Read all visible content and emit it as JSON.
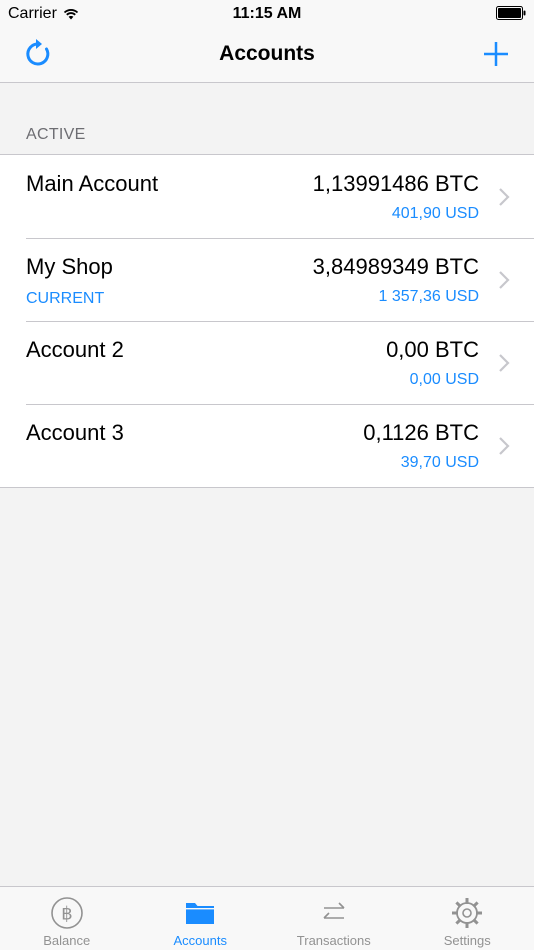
{
  "status_bar": {
    "carrier": "Carrier",
    "time": "11:15 AM"
  },
  "nav": {
    "title": "Accounts",
    "left_icon": "refresh-icon",
    "right_icon": "plus-icon"
  },
  "section": {
    "header": "ACTIVE"
  },
  "accounts": [
    {
      "name": "Main Account",
      "subtitle": "",
      "btc": "1,13991486 BTC",
      "usd": "401,90 USD"
    },
    {
      "name": "My Shop",
      "subtitle": "CURRENT",
      "btc": "3,84989349 BTC",
      "usd": "1 357,36 USD"
    },
    {
      "name": "Account 2",
      "subtitle": "",
      "btc": "0,00 BTC",
      "usd": "0,00 USD"
    },
    {
      "name": "Account 3",
      "subtitle": "",
      "btc": "0,1126 BTC",
      "usd": "39,70 USD"
    }
  ],
  "tabs": [
    {
      "label": "Balance",
      "icon": "bitcoin-icon",
      "active": false
    },
    {
      "label": "Accounts",
      "icon": "folder-icon",
      "active": true
    },
    {
      "label": "Transactions",
      "icon": "transfer-arrows-icon",
      "active": false
    },
    {
      "label": "Settings",
      "icon": "gear-icon",
      "active": false
    }
  ],
  "colors": {
    "accent": "#1a8cff",
    "inactive": "#929292",
    "separator": "#c8c7cc",
    "background": "#f3f3f3"
  }
}
